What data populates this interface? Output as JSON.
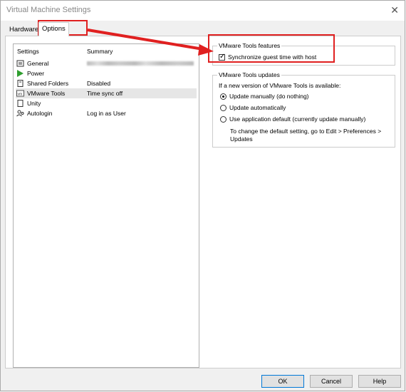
{
  "window": {
    "title": "Virtual Machine Settings",
    "close_glyph": "✕"
  },
  "tabs": [
    {
      "label": "Hardware"
    },
    {
      "label": "Options"
    }
  ],
  "settings_list": {
    "col_settings": "Settings",
    "col_summary": "Summary",
    "items": [
      {
        "name": "General",
        "summary": "",
        "icon": "general-icon"
      },
      {
        "name": "Power",
        "summary": "",
        "icon": "power-icon"
      },
      {
        "name": "Shared Folders",
        "summary": "Disabled",
        "icon": "shared-folders-icon"
      },
      {
        "name": "VMware Tools",
        "summary": "Time sync off",
        "icon": "vmware-tools-icon"
      },
      {
        "name": "Unity",
        "summary": "",
        "icon": "unity-icon"
      },
      {
        "name": "Autologin",
        "summary": "Log in as User",
        "icon": "autologin-icon"
      }
    ]
  },
  "features": {
    "title": "VMware Tools features",
    "sync_label": "Synchronize guest time with host"
  },
  "updates": {
    "title": "VMware Tools updates",
    "intro": "If a new version of VMware Tools is available:",
    "options": [
      {
        "label": "Update manually (do nothing)"
      },
      {
        "label": "Update automatically"
      },
      {
        "label": "Use application default (currently update manually)"
      }
    ],
    "note_line1": "To change the default setting, go to Edit > Preferences >",
    "note_line2": "Updates"
  },
  "buttons": {
    "ok": "OK",
    "cancel": "Cancel",
    "help": "Help"
  },
  "colors": {
    "highlight": "#e02020",
    "power": "#2e9e2e"
  }
}
